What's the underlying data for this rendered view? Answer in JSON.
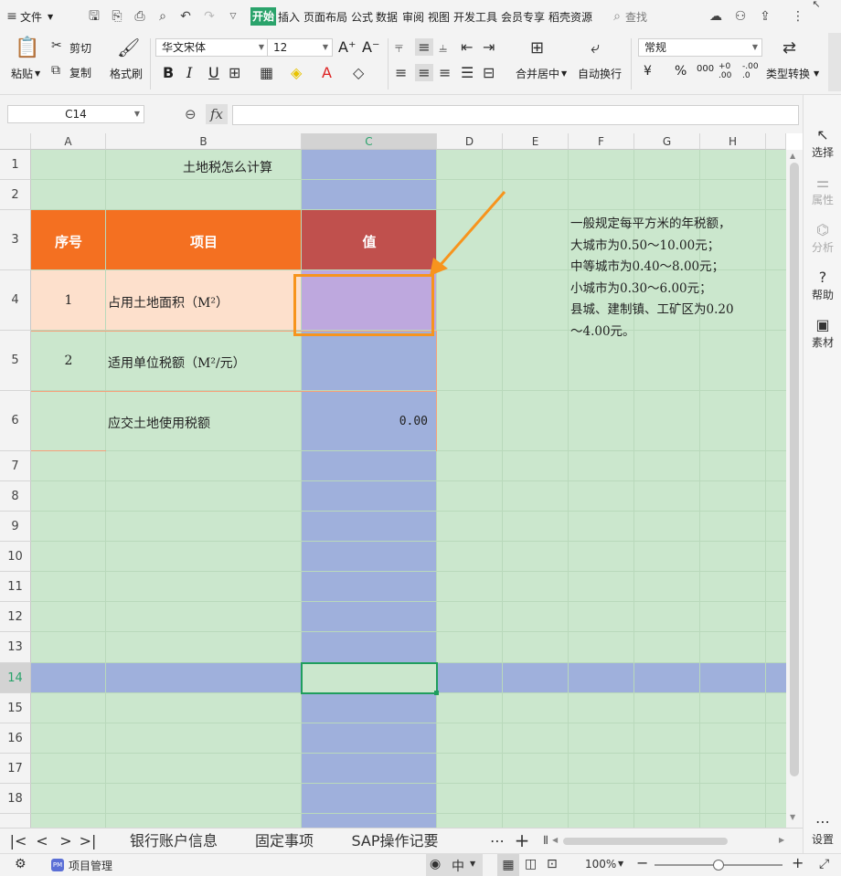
{
  "menu": {
    "file": "文件",
    "tabs": [
      "开始",
      "插入",
      "页面布局",
      "公式",
      "数据",
      "审阅",
      "视图",
      "开发工具",
      "会员专享",
      "稻壳资源"
    ],
    "search": "查找"
  },
  "ribbon": {
    "paste": "粘贴",
    "cut": "剪切",
    "copy": "复制",
    "format_painter": "格式刷",
    "font_name": "华文宋体",
    "font_size": "12",
    "merge_center": "合并居中",
    "wrap_text": "自动换行",
    "number_format": "常规",
    "type_convert": "类型转换",
    "increase_font": "A⁺",
    "decrease_font": "A⁻",
    "bold": "B",
    "italic": "I",
    "underline": "U",
    "currency": "¥",
    "percent": "%",
    "thousands": "000",
    "inc_decimal": "+0 .00",
    "dec_decimal": "-.00 .0"
  },
  "formula_bar": {
    "cell_ref": "C14",
    "fx": "fx",
    "content": ""
  },
  "grid": {
    "columns": [
      "A",
      "B",
      "C",
      "D",
      "E",
      "F",
      "G",
      "H"
    ],
    "rows": [
      "1",
      "2",
      "3",
      "4",
      "5",
      "6",
      "7",
      "8",
      "9",
      "10",
      "11",
      "12",
      "13",
      "14",
      "15",
      "16",
      "17",
      "18"
    ],
    "title": "土地税怎么计算",
    "header": {
      "seq": "序号",
      "item": "项目",
      "value": "值"
    },
    "rows_data": [
      {
        "seq": "1",
        "item": "占用土地面积（M²）",
        "value": ""
      },
      {
        "seq": "2",
        "item": "适用单位税额（M²/元）",
        "value": ""
      },
      {
        "seq": "",
        "item": "应交土地使用税额",
        "value": "0.00"
      }
    ],
    "note": [
      "一般规定每平方米的年税额，",
      "大城市为0.50～10.00元；",
      "中等城市为0.40～8.00元；",
      "小城市为0.30～6.00元；",
      "县城、建制镇、工矿区为0.20",
      "～4.00元。"
    ]
  },
  "sheets": [
    "银行账户信息",
    "固定事项",
    "SAP操作记要"
  ],
  "status": {
    "project": "项目管理",
    "zoom": "100%"
  },
  "right_panel": [
    "选择",
    "属性",
    "分析",
    "帮助",
    "素材",
    "设置"
  ],
  "colors": {
    "orange": "#f47021",
    "header_value": "#c0504d",
    "highlight_col": "#9fb0dc",
    "grid_bg": "#cbe7cd",
    "selected_cell": "#bea8de",
    "row4_bg": "#fde0cc",
    "annotation": "#f7941d"
  }
}
